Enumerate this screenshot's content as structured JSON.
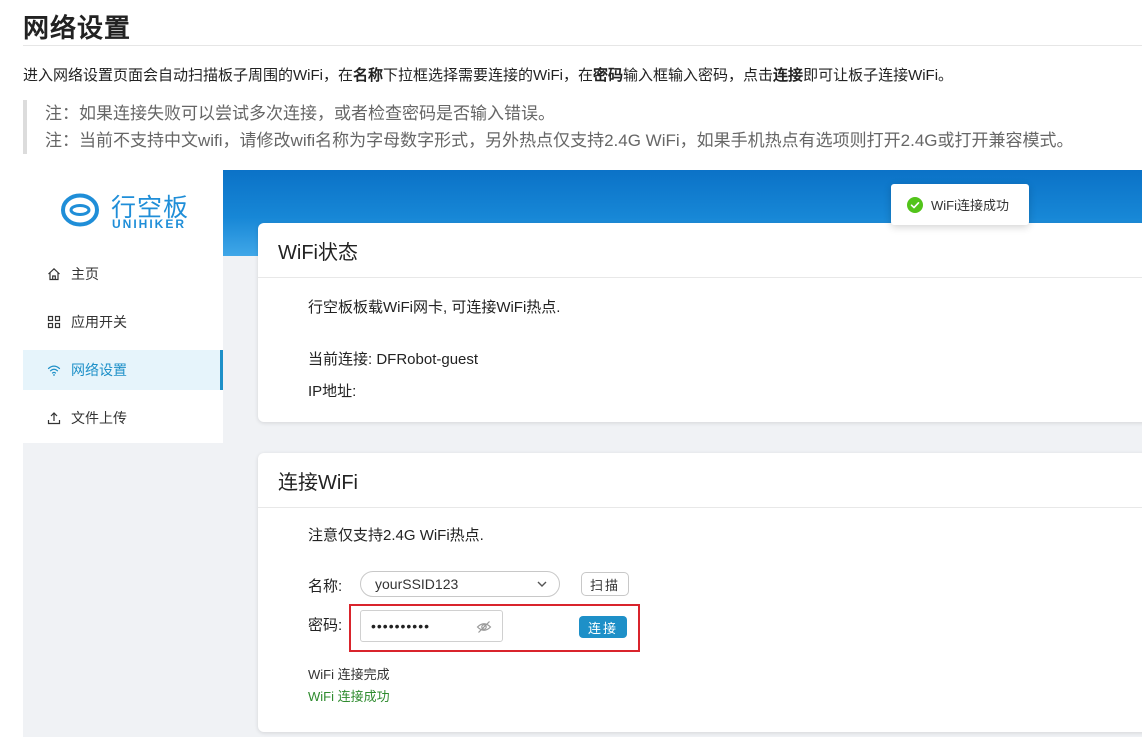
{
  "doc": {
    "title": "网络设置",
    "intro": {
      "p1": "进入网络设置页面会自动扫描板子周围的WiFi，在",
      "b1": "名称",
      "p2": "下拉框选择需要连接的WiFi，在",
      "b2": "密码",
      "p3": "输入框输入密码，点击",
      "b3": "连接",
      "p4": "即可让板子连接WiFi。"
    },
    "notes": [
      "注：如果连接失败可以尝试多次连接，或者检查密码是否输入错误。",
      "注：当前不支持中文wifi，请修改wifi名称为字母数字形式，另外热点仅支持2.4G WiFi，如果手机热点有选项则打开2.4G或打开兼容模式。"
    ]
  },
  "app": {
    "logo": {
      "cn": "行空板",
      "en": "UNIHIKER"
    },
    "nav": [
      {
        "label": "主页",
        "icon": "home-icon"
      },
      {
        "label": "应用开关",
        "icon": "grid-icon"
      },
      {
        "label": "网络设置",
        "icon": "wifi-icon",
        "active": true
      },
      {
        "label": "文件上传",
        "icon": "upload-icon"
      }
    ],
    "toast": {
      "text": "WiFi连接成功",
      "icon": "check-circle-icon",
      "color": "#52c41a"
    },
    "status_card": {
      "title": "WiFi状态",
      "desc": "行空板板载WiFi网卡, 可连接WiFi热点.",
      "current_label": "当前连接:",
      "current_value": "DFRobot-guest",
      "ip_label": "IP地址:",
      "ip_value": ""
    },
    "connect_card": {
      "title": "连接WiFi",
      "note": "注意仅支持2.4G WiFi热点.",
      "name_label": "名称:",
      "ssid": "yourSSID123",
      "scan_label": "扫描",
      "password_label": "密码:",
      "password_value": "••••••••••",
      "connect_label": "连接",
      "log": [
        "WiFi 连接完成",
        "WiFi 连接成功"
      ]
    },
    "colors": {
      "accent": "#1e90c8",
      "success_text": "#2e8b2e",
      "highlight_border": "#d9242c"
    }
  }
}
